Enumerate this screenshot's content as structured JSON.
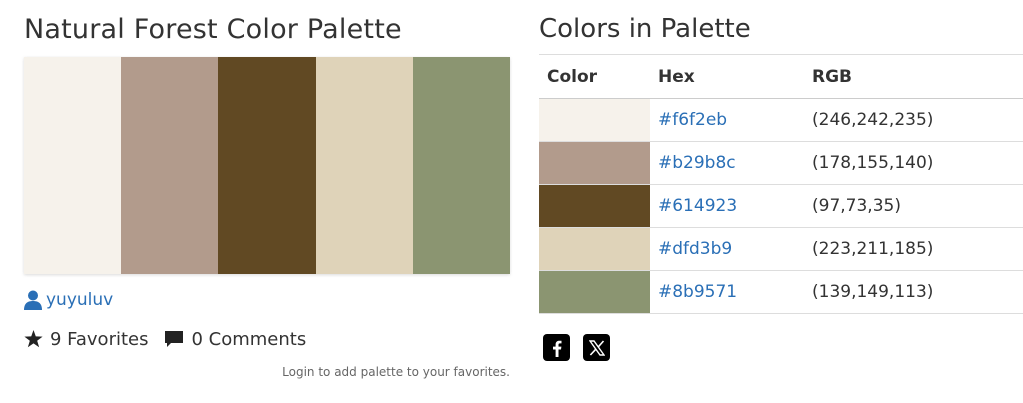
{
  "title": "Natural Forest Color Palette",
  "palette": [
    {
      "hex": "#f6f2eb",
      "rgb": "(246,242,235)"
    },
    {
      "hex": "#b29b8c",
      "rgb": "(178,155,140)"
    },
    {
      "hex": "#614923",
      "rgb": "(97,73,35)"
    },
    {
      "hex": "#dfd3b9",
      "rgb": "(223,211,185)"
    },
    {
      "hex": "#8b9571",
      "rgb": "(139,149,113)"
    }
  ],
  "author": {
    "name": "yuyuluv",
    "icon": "user-icon"
  },
  "stats": {
    "favorites": "9 Favorites",
    "comments": "0 Comments"
  },
  "login_note": "Login to add palette to your favorites.",
  "colors_section": {
    "title": "Colors in Palette",
    "headers": {
      "color": "Color",
      "hex": "Hex",
      "rgb": "RGB"
    }
  },
  "social": [
    {
      "name": "facebook",
      "icon": "facebook-icon"
    },
    {
      "name": "x",
      "icon": "x-icon"
    }
  ],
  "accent_color": "#2a6fb6"
}
